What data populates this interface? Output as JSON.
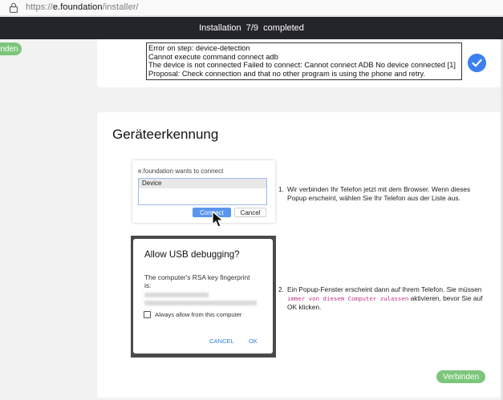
{
  "browser": {
    "url_prefix": "https://",
    "url_host": "e.foundation",
    "url_path": "/installer/"
  },
  "status_bar": {
    "text": "Installation  7/9  completed"
  },
  "sidebar": {
    "button_label": "nden"
  },
  "error_box": {
    "lines": [
      "Error on step: device-detection",
      "Cannot execute command connect adb",
      "The device is not connected Failed to connect: Cannot connect ADB No device connected [1]",
      "Proposal: Check connection and that no other program is using the phone and retry."
    ]
  },
  "main": {
    "title": "Geräteerkennung",
    "connect_dialog": {
      "title": "e.foundation wants to connect",
      "device_item": "Device",
      "connect_label": "Connect",
      "cancel_label": "Cancel"
    },
    "step1": {
      "number": "1.",
      "text": "Wir verbinden Ihr Telefon jetzt mit dem Browser. Wenn dieses Popup erscheint, wählen Sie Ihr Telefon aus der Liste aus."
    },
    "usb_dialog": {
      "title": "Allow USB debugging?",
      "body": "The computer's RSA key fingerprint is:",
      "checkbox_label": "Always allow from this computer",
      "cancel_label": "CANCEL",
      "ok_label": "OK"
    },
    "step2": {
      "number": "2.",
      "text_before": "Ein Popup-Fenster erscheint dann auf Ihrem Telefon. Sie müssen ",
      "code": "immer von diesem Computer zulassen",
      "text_after": " aktivieren, bevor Sie auf OK klicken."
    },
    "verbinden_label": "Verbinden"
  },
  "colors": {
    "status_bar": "#24252b",
    "green_button": "#7bc67b",
    "check_blue": "#3b80ee",
    "code_pink": "#c0388f"
  }
}
